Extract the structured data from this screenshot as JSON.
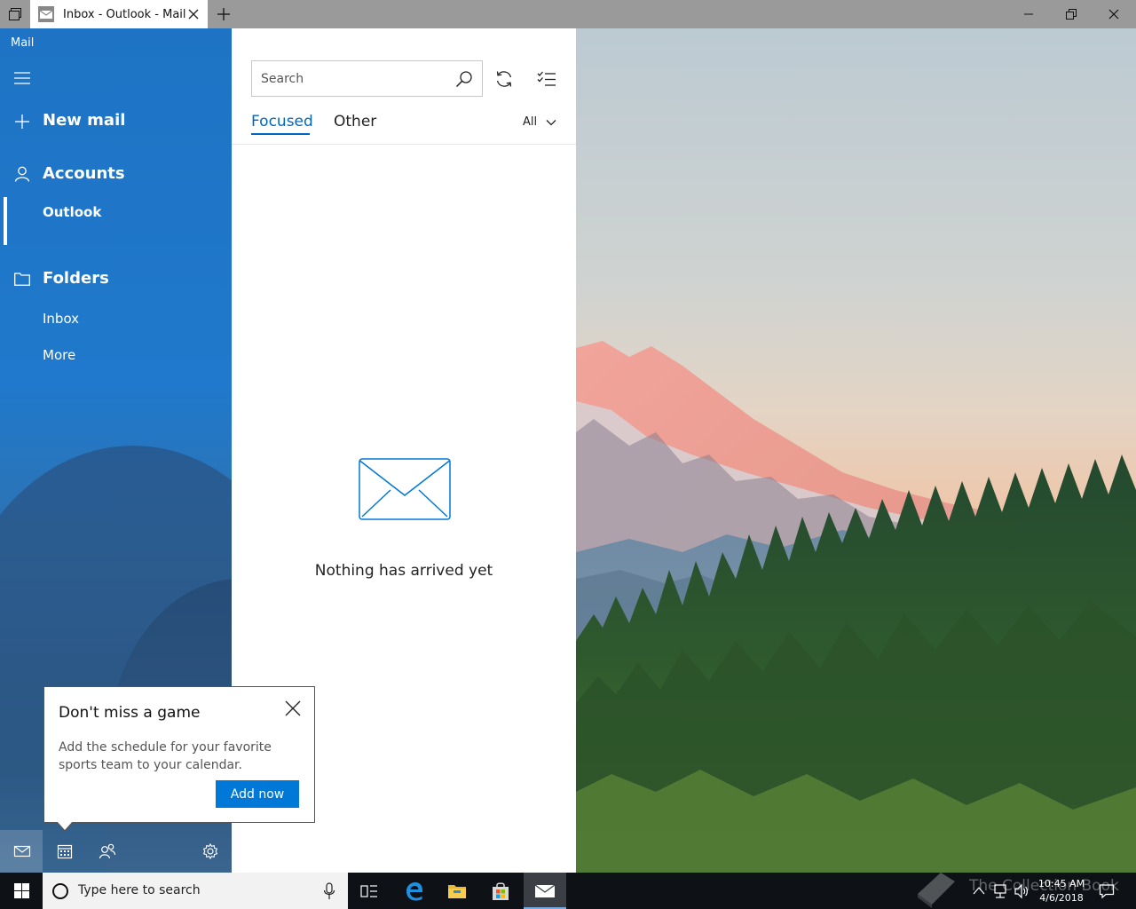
{
  "window": {
    "tab_title": "Inbox - Outlook - Mail"
  },
  "nav": {
    "app_name": "Mail",
    "new_mail": "New mail",
    "accounts_header": "Accounts",
    "account_item": "Outlook",
    "folders_header": "Folders",
    "folders": [
      "Inbox",
      "More"
    ]
  },
  "list": {
    "search_placeholder": "Search",
    "tabs": {
      "focused": "Focused",
      "other": "Other"
    },
    "filter": "All",
    "empty_message": "Nothing has arrived yet"
  },
  "tip": {
    "title": "Don't miss a game",
    "body": "Add the schedule for your favorite sports team to your calendar.",
    "button": "Add now"
  },
  "taskbar": {
    "search_placeholder": "Type here to search",
    "time": "10:45 AM",
    "date": "4/6/2018",
    "watermark": "The Collection Book"
  },
  "colors": {
    "accent": "#0078d7",
    "nav_blue": "#1e73c4",
    "focused_tab": "#0067c0"
  }
}
